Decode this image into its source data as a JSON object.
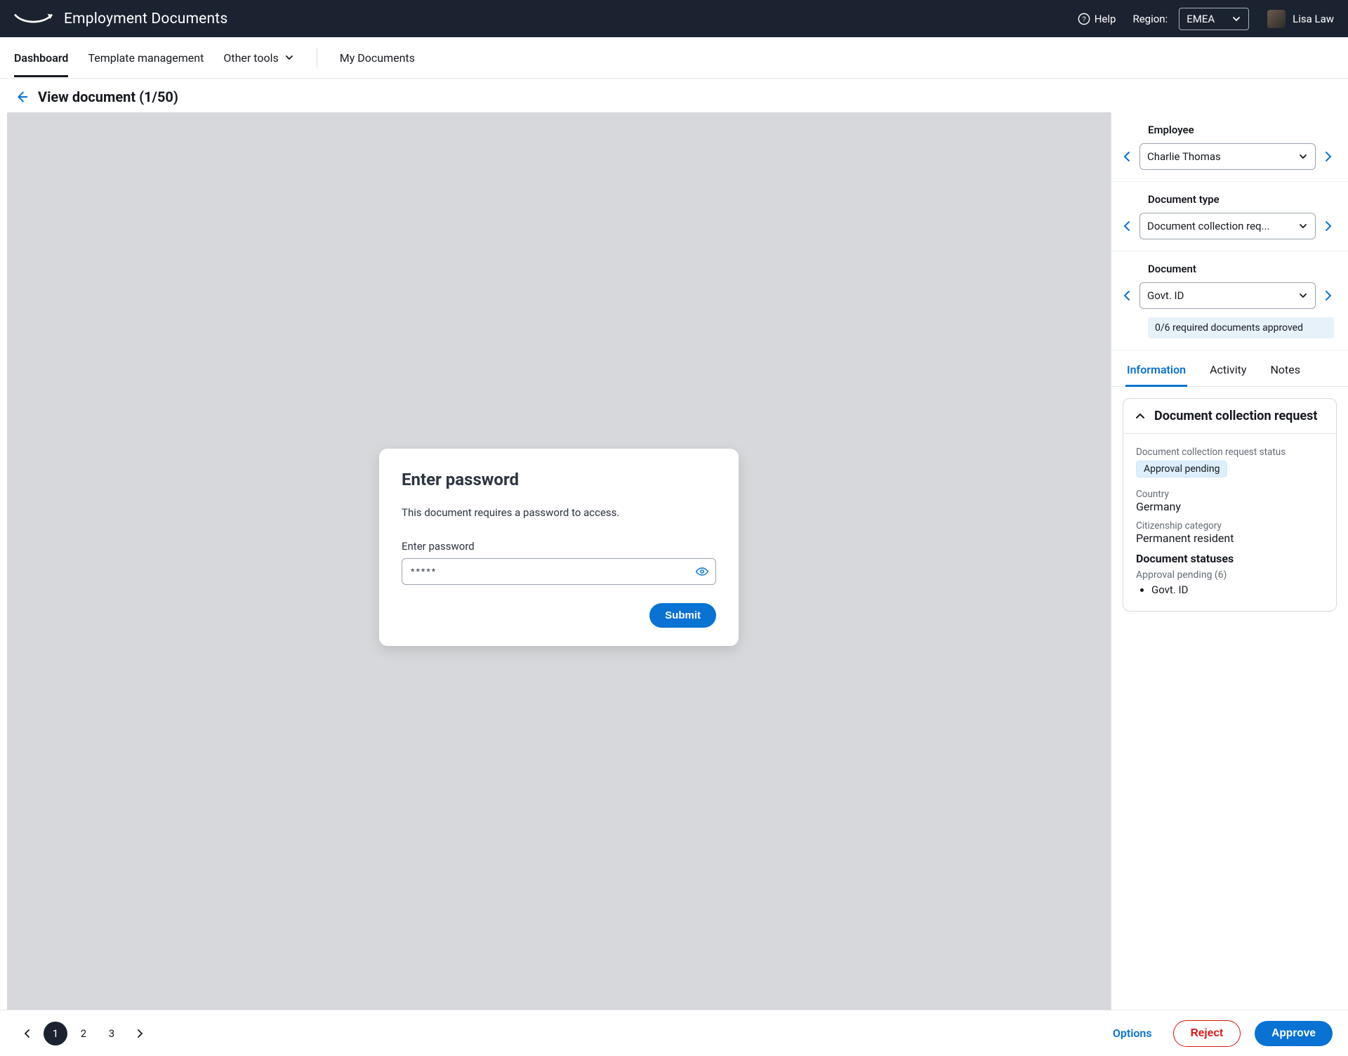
{
  "header": {
    "title": "Employment Documents",
    "help": "Help",
    "region_label": "Region:",
    "region_value": "EMEA",
    "user_name": "Lisa Law"
  },
  "nav": {
    "dashboard": "Dashboard",
    "templates": "Template management",
    "other": "Other tools",
    "my_docs": "My Documents"
  },
  "page": {
    "title": "View document (1/50)"
  },
  "password_modal": {
    "heading": "Enter password",
    "description": "This document requires a password to access.",
    "field_label": "Enter password",
    "value": "*****",
    "submit": "Submit"
  },
  "sidebar": {
    "employee_label": "Employee",
    "employee_value": "Charlie Thomas",
    "doctype_label": "Document type",
    "doctype_value": "Document collection req...",
    "document_label": "Document",
    "document_value": "Govt. ID",
    "approved_summary": "0/6 required documents approved"
  },
  "tabs": {
    "info": "Information",
    "activity": "Activity",
    "notes": "Notes"
  },
  "info": {
    "card_title": "Document collection request",
    "status_label": "Document collection request status",
    "status_value": "Approval pending",
    "country_label": "Country",
    "country_value": "Germany",
    "citizenship_label": "Citizenship category",
    "citizenship_value": "Permanent resident",
    "statuses_heading": "Document statuses",
    "pending_group": "Approval pending (6)",
    "pending_items": [
      "Govt. ID"
    ]
  },
  "footer": {
    "pages": [
      "1",
      "2",
      "3"
    ],
    "current_page": "1",
    "options": "Options",
    "reject": "Reject",
    "approve": "Approve"
  }
}
